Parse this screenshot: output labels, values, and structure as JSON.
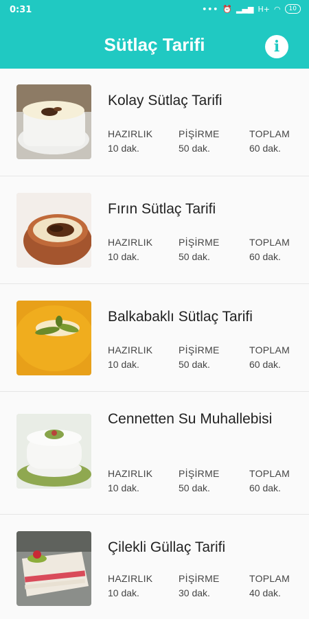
{
  "status_bar": {
    "time": "0:31",
    "network": "H+",
    "battery": "10"
  },
  "app_bar": {
    "title": "Sütlaç Tarifi",
    "info_icon": "info-icon"
  },
  "labels": {
    "prep": "HAZIRLIK",
    "cook": "PİŞİRME",
    "total": "TOPLAM"
  },
  "recipes": [
    {
      "name": "Kolay Sütlaç Tarifi",
      "prep": "10 dak.",
      "cook": "50 dak.",
      "total": "60 dak."
    },
    {
      "name": "Fırın Sütlaç Tarifi",
      "prep": "10 dak.",
      "cook": "50 dak.",
      "total": "60 dak."
    },
    {
      "name": "Balkabaklı Sütlaç Tarifi",
      "prep": "10 dak.",
      "cook": "50 dak.",
      "total": "60 dak."
    },
    {
      "name": "Cennetten Su Muhallebisi",
      "prep": "10 dak.",
      "cook": "50 dak.",
      "total": "60 dak."
    },
    {
      "name": "Çilekli Güllaç Tarifi",
      "prep": "10 dak.",
      "cook": "30 dak.",
      "total": "40 dak."
    }
  ],
  "colors": {
    "accent": "#20c9c2"
  }
}
